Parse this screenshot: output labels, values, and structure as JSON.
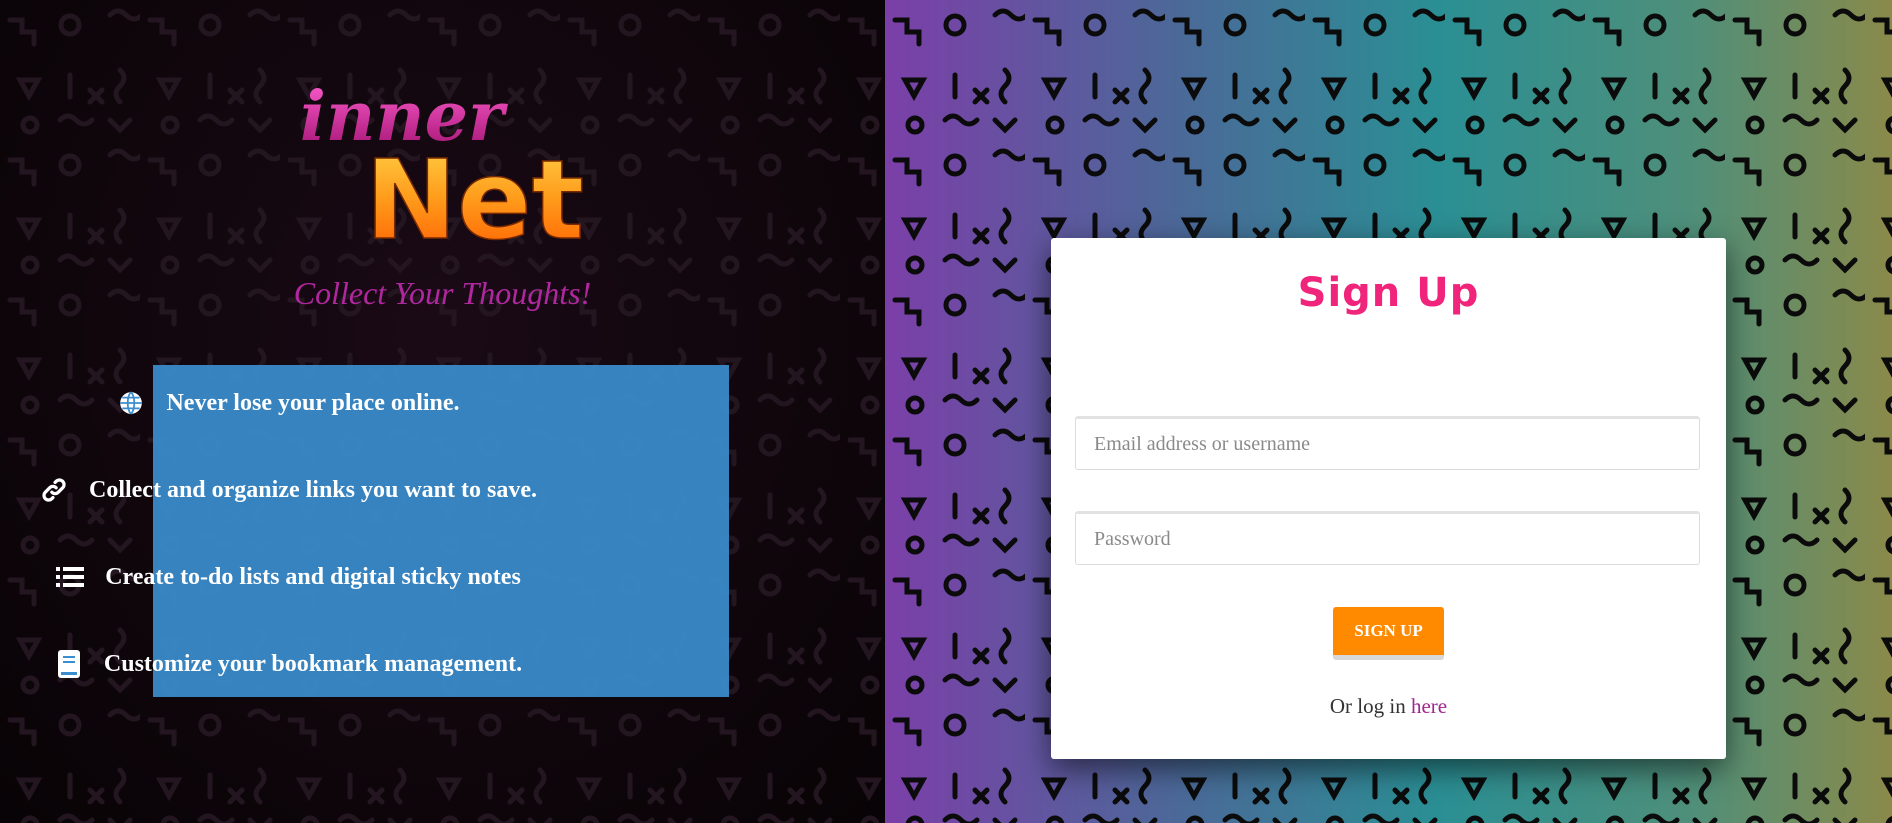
{
  "brand": {
    "logo_top": "inner",
    "logo_bottom": "Net",
    "tagline": "Collect Your Thoughts!"
  },
  "features": [
    {
      "icon": "globe-icon",
      "text": "Never lose your place online."
    },
    {
      "icon": "link-icon",
      "text": "Collect and organize links you want to save."
    },
    {
      "icon": "list-icon",
      "text": "Create to-do lists and digital sticky notes"
    },
    {
      "icon": "book-icon",
      "text": "Customize your bookmark management."
    }
  ],
  "signup": {
    "title": "Sign Up",
    "email_placeholder": "Email address or username",
    "email_value": "",
    "password_placeholder": "Password",
    "password_value": "",
    "button_label": "SIGN UP",
    "login_prefix": "Or log in",
    "login_link": "here"
  },
  "colors": {
    "accent_pink": "#f0247a",
    "button_orange": "#ff8a00",
    "feature_blue": "#3a8dce",
    "tagline_magenta": "#b0279f"
  }
}
